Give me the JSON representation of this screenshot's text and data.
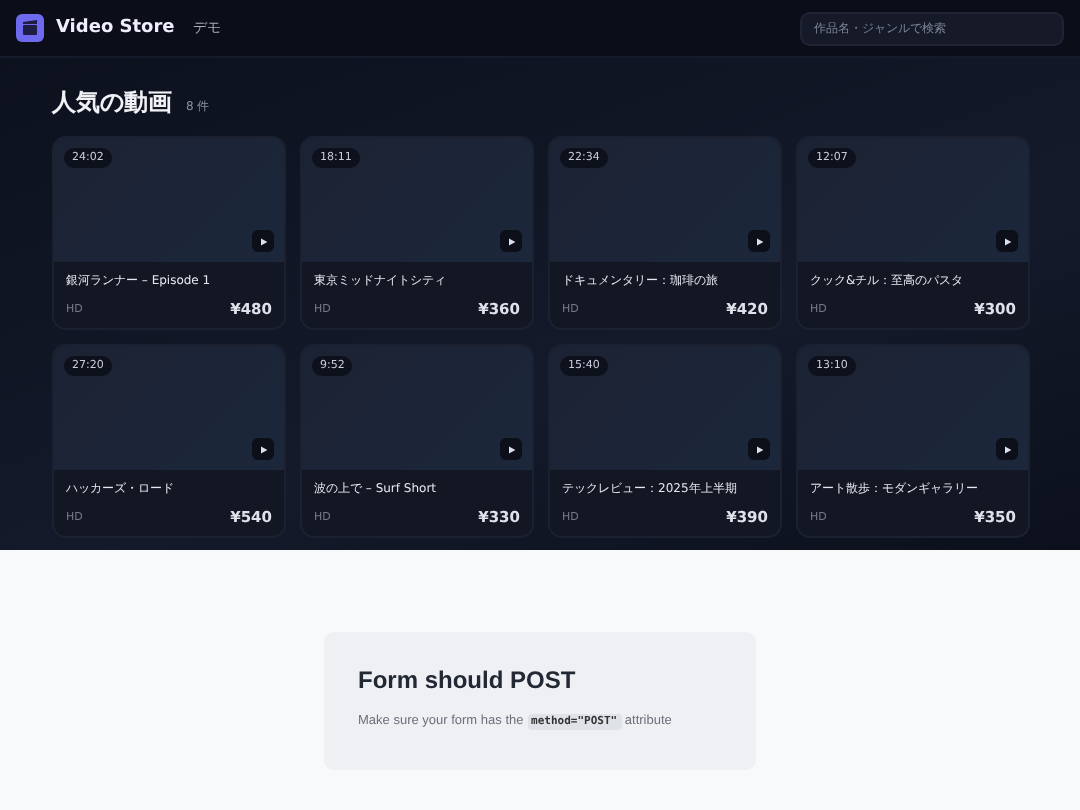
{
  "header": {
    "brand": "Video Store",
    "tag": "デモ",
    "search": {
      "placeholder": "作品名・ジャンルで検索"
    }
  },
  "section": {
    "title": "人気の動画",
    "count": "8 件"
  },
  "videos": [
    {
      "duration": "24:02",
      "title": "銀河ランナー – Episode 1",
      "quality": "HD",
      "price": "¥480"
    },
    {
      "duration": "18:11",
      "title": "東京ミッドナイトシティ",
      "quality": "HD",
      "price": "¥360"
    },
    {
      "duration": "22:34",
      "title": "ドキュメンタリー：珈琲の旅",
      "quality": "HD",
      "price": "¥420"
    },
    {
      "duration": "12:07",
      "title": "クック&チル：至高のパスタ",
      "quality": "HD",
      "price": "¥300"
    },
    {
      "duration": "27:20",
      "title": "ハッカーズ・ロード",
      "quality": "HD",
      "price": "¥540"
    },
    {
      "duration": "9:52",
      "title": "波の上で – Surf Short",
      "quality": "HD",
      "price": "¥330"
    },
    {
      "duration": "15:40",
      "title": "テックレビュー：2025年上半期",
      "quality": "HD",
      "price": "¥390"
    },
    {
      "duration": "13:10",
      "title": "アート散歩：モダンギャラリー",
      "quality": "HD",
      "price": "¥350"
    }
  ],
  "notice": {
    "title": "Form should POST",
    "text_before": "Make sure your form has the",
    "code": "method=\"POST\"",
    "text_after": "attribute"
  }
}
